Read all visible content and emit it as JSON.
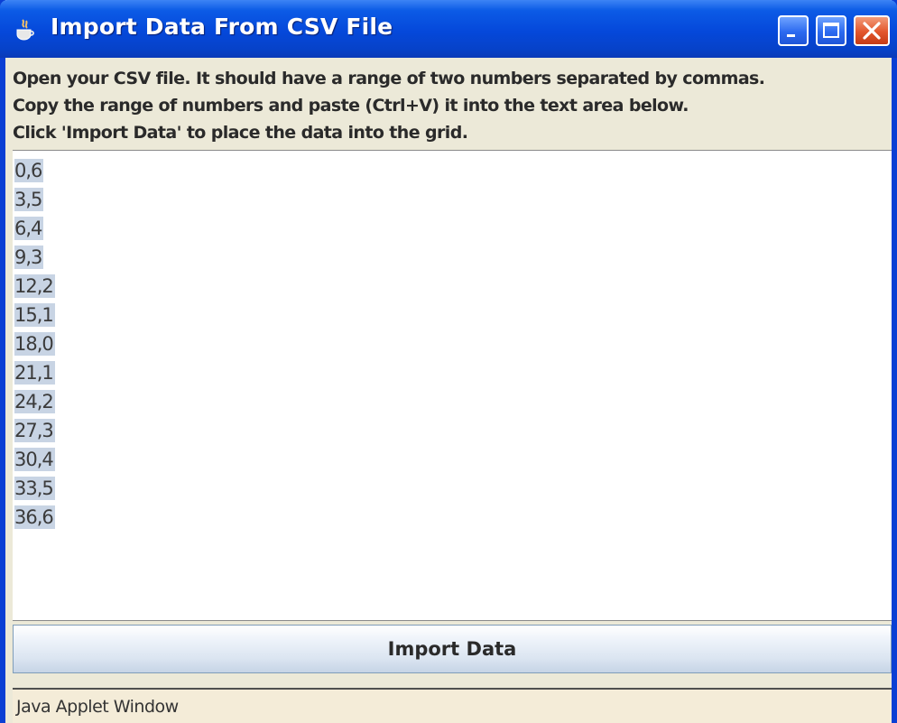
{
  "window": {
    "title": "Import Data From CSV File",
    "icon": "java-cup-icon",
    "controls": {
      "minimize": "minimize-icon",
      "maximize": "maximize-icon",
      "close": "close-icon"
    }
  },
  "instructions": [
    "Open your CSV file.  It should have a range of two numbers separated by commas.",
    "Copy the range of numbers and paste (Ctrl+V) it into the text area below.",
    "Click 'Import Data' to place the data into the grid."
  ],
  "textarea": {
    "lines": [
      "0,6",
      "3,5",
      "6,4",
      "9,3",
      "12,2",
      "15,1",
      "18,0",
      "21,1",
      "24,2",
      "27,3",
      "30,4",
      "33,5",
      "36,6"
    ]
  },
  "import_button": {
    "label": "Import Data"
  },
  "status": {
    "text": "Java Applet Window"
  },
  "colors": {
    "title_bar": "#0548da",
    "selection": "#c8d4e4",
    "close_button": "#e2562c"
  }
}
